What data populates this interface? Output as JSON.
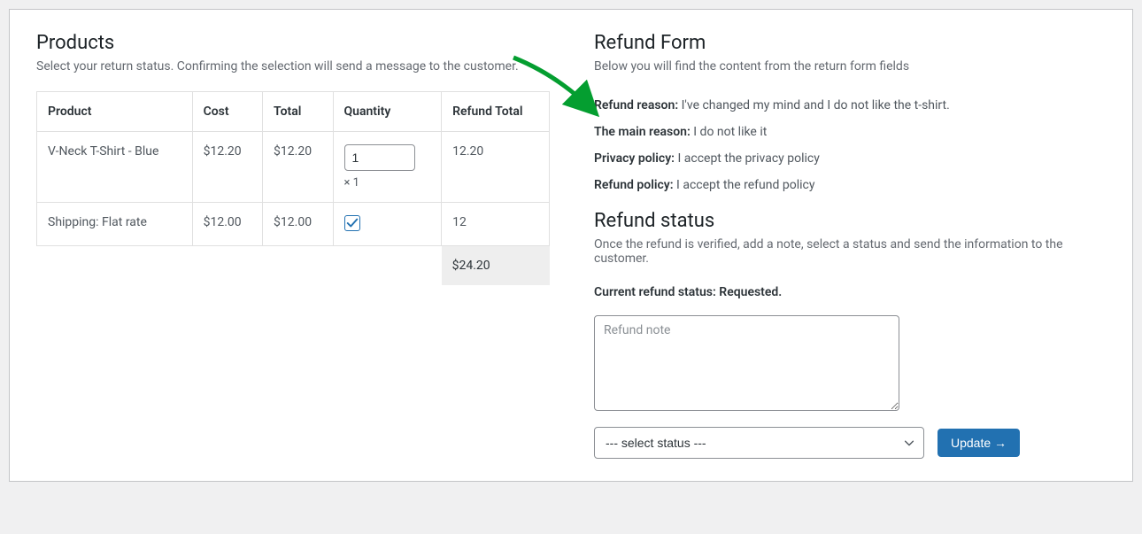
{
  "products": {
    "title": "Products",
    "subtitle": "Select your return status. Confirming the selection will send a message to the customer.",
    "headers": {
      "product": "Product",
      "cost": "Cost",
      "total": "Total",
      "quantity": "Quantity",
      "refund_total": "Refund Total"
    },
    "rows": [
      {
        "product": "V-Neck T-Shirt - Blue",
        "cost": "$12.20",
        "total": "$12.20",
        "qty_value": "1",
        "qty_note": "× 1",
        "refund_total": "12.20",
        "type": "qty"
      },
      {
        "product": "Shipping: Flat rate",
        "cost": "$12.00",
        "total": "$12.00",
        "checked": true,
        "refund_total": "12",
        "type": "check"
      }
    ],
    "grand_total": "$24.20"
  },
  "refund_form": {
    "title": "Refund Form",
    "subtitle": "Below you will find the content from the return form fields",
    "fields": [
      {
        "label": "Refund reason",
        "value": "I've changed my mind and I do not like the t-shirt."
      },
      {
        "label": "The main reason",
        "value": "I do not like it"
      },
      {
        "label": "Privacy policy",
        "value": "I accept the privacy policy"
      },
      {
        "label": "Refund policy",
        "value": "I accept the refund policy"
      }
    ]
  },
  "refund_status": {
    "title": "Refund status",
    "subtitle": "Once the refund is verified, add a note, select a status and send the information to the customer.",
    "current_label": "Current refund status:",
    "current_value": "Requested.",
    "note_placeholder": "Refund note",
    "select_placeholder": "--- select status ---",
    "button": "Update →"
  }
}
